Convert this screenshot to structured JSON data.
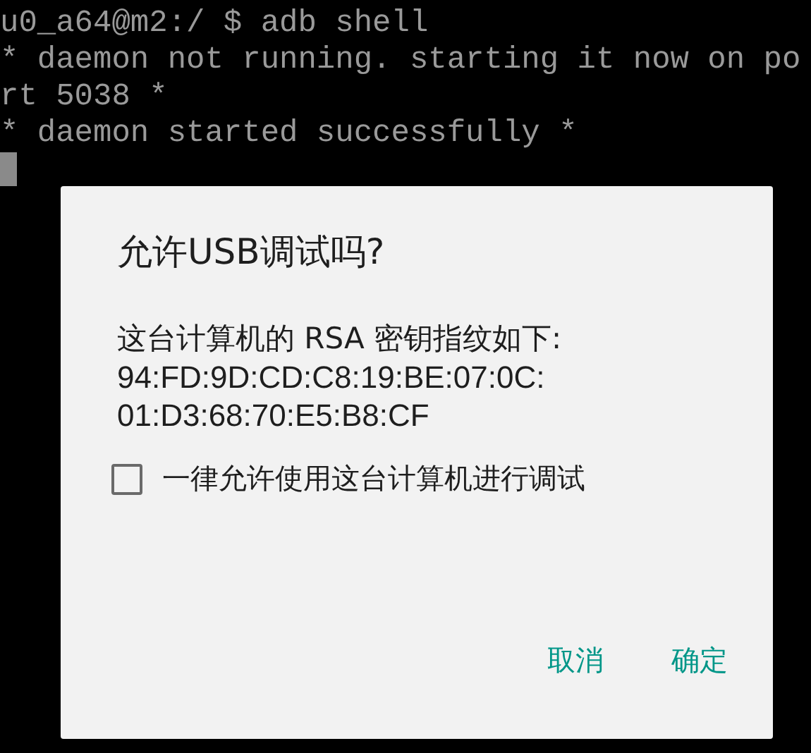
{
  "terminal": {
    "lines": [
      "u0_a64@m2:/ $ adb shell",
      "* daemon not running. starting it now on po",
      "rt 5038 *",
      "* daemon started successfully *"
    ],
    "cursor": true
  },
  "dialog": {
    "title": "允许USB调试吗?",
    "message": "这台计算机的 RSA 密钥指纹如下:",
    "fingerprint": [
      "94:FD:9D:CD:C8:19:BE:07:0C:",
      "01:D3:68:70:E5:B8:CF"
    ],
    "checkbox": {
      "label": "一律允许使用这台计算机进行调试",
      "checked": false
    },
    "buttons": [
      "取消",
      "确定"
    ]
  }
}
